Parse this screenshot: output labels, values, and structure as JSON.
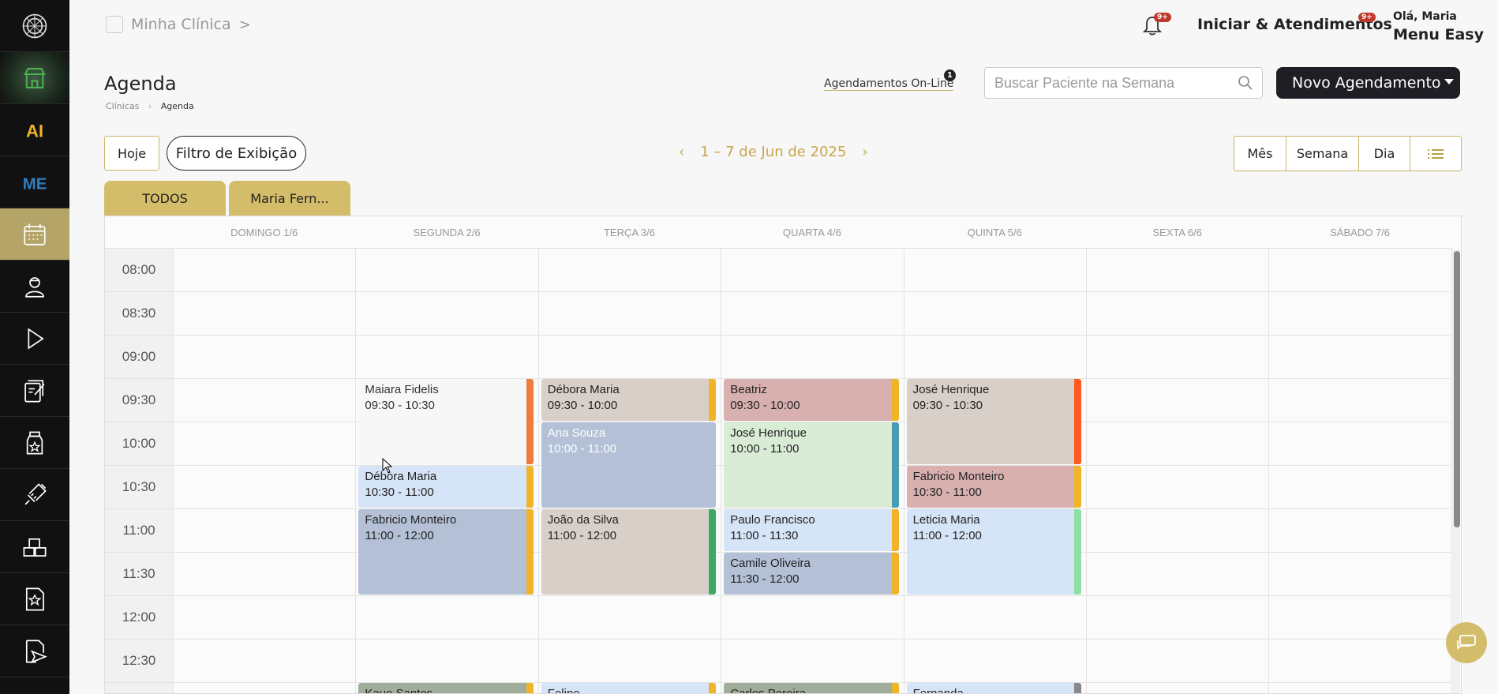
{
  "header": {
    "clinic_name": "Minha Clínica",
    "clinic_chevron": ">",
    "notif_badge": "9+",
    "iniciar_label": "Iniciar & Atendimentos",
    "iniciar_badge": "9+",
    "greeting": "Olá, Maria",
    "menu_label": "Menu Easy"
  },
  "page": {
    "title": "Agenda",
    "breadcrumb": [
      "Clínicas",
      "Agenda"
    ],
    "online_link": "Agendamentos On-Line",
    "online_badge": "1",
    "search_placeholder": "Buscar Paciente na Semana",
    "new_button": "Novo Agendamento"
  },
  "toolbar": {
    "today": "Hoje",
    "filter": "Filtro de Exibição",
    "date_range": "1 – 7 de Jun de 2025",
    "views": [
      "Mês",
      "Semana",
      "Dia"
    ]
  },
  "tabs": [
    "TODOS",
    "Maria Fern..."
  ],
  "days": [
    "DOMINGO 1/6",
    "SEGUNDA 2/6",
    "TERÇA 3/6",
    "QUARTA 4/6",
    "QUINTA 5/6",
    "SEXTA 6/6",
    "SÁBADO 7/6"
  ],
  "times": [
    "08:00",
    "08:30",
    "09:00",
    "09:30",
    "10:00",
    "10:30",
    "11:00",
    "11:30",
    "12:00",
    "12:30"
  ],
  "appointments": [
    {
      "name": "Maiara Fidelis",
      "time": "09:30 - 10:30",
      "day": 1,
      "start": 3,
      "slots": 2,
      "bg": "#f7f7f7",
      "bar": "#f07b3f",
      "text": "#333"
    },
    {
      "name": "Débora Maria",
      "time": "10:30 - 11:00",
      "day": 1,
      "start": 5,
      "slots": 1,
      "bg": "#d6e4f7",
      "bar": "#f0b429",
      "text": "#222"
    },
    {
      "name": "Fabricio Monteiro",
      "time": "11:00 - 12:00",
      "day": 1,
      "start": 6,
      "slots": 2,
      "bg": "#b3c0d6",
      "bar": "#f0b429",
      "text": "#222"
    },
    {
      "name": "Kaue Santos",
      "time": "",
      "day": 1,
      "start": 10,
      "slots": 1,
      "bg": "#9fad9a",
      "bar": "#f0b429",
      "text": "#222"
    },
    {
      "name": "Débora Maria",
      "time": "09:30 - 10:00",
      "day": 2,
      "start": 3,
      "slots": 1,
      "bg": "#d8cfc9",
      "bar": "#f0b429",
      "text": "#222"
    },
    {
      "name": "Ana Souza",
      "time": "10:00 - 11:00",
      "day": 2,
      "start": 4,
      "slots": 2,
      "bg": "#b3c0d6",
      "bar": "#b3c0d6",
      "text": "#ffffff"
    },
    {
      "name": "João da Silva",
      "time": "11:00 - 12:00",
      "day": 2,
      "start": 6,
      "slots": 2,
      "bg": "#d8cfc9",
      "bar": "#3fa862",
      "text": "#222"
    },
    {
      "name": "Felipe",
      "time": "",
      "day": 2,
      "start": 10,
      "slots": 1,
      "bg": "#d6e4f7",
      "bar": "#f0b429",
      "text": "#222"
    },
    {
      "name": "Beatriz",
      "time": "09:30 - 10:00",
      "day": 3,
      "start": 3,
      "slots": 1,
      "bg": "#d9b0b0",
      "bar": "#f0b429",
      "text": "#222"
    },
    {
      "name": "José Henrique",
      "time": "10:00 - 11:00",
      "day": 3,
      "start": 4,
      "slots": 2,
      "bg": "#d9ecd6",
      "bar": "#4a9db0",
      "text": "#222"
    },
    {
      "name": "Paulo Francisco",
      "time": "11:00 - 11:30",
      "day": 3,
      "start": 6,
      "slots": 1,
      "bg": "#d6e4f7",
      "bar": "#f0b429",
      "text": "#222"
    },
    {
      "name": "Camile Oliveira",
      "time": "11:30 - 12:00",
      "day": 3,
      "start": 7,
      "slots": 1,
      "bg": "#b3c0d6",
      "bar": "#f0b429",
      "text": "#222"
    },
    {
      "name": "Carlos Pereira",
      "time": "",
      "day": 3,
      "start": 10,
      "slots": 1,
      "bg": "#9fad9a",
      "bar": "#f0b429",
      "text": "#222"
    },
    {
      "name": "José Henrique",
      "time": "09:30 - 10:30",
      "day": 4,
      "start": 3,
      "slots": 2,
      "bg": "#d8cfc9",
      "bar": "#ff5a1f",
      "text": "#222"
    },
    {
      "name": "Fabricio Monteiro",
      "time": "10:30 - 11:00",
      "day": 4,
      "start": 5,
      "slots": 1,
      "bg": "#d9b0b0",
      "bar": "#f0b429",
      "text": "#222"
    },
    {
      "name": "Leticia Maria",
      "time": "11:00 - 12:00",
      "day": 4,
      "start": 6,
      "slots": 2,
      "bg": "#d6e4f7",
      "bar": "#8fe0a8",
      "text": "#222"
    },
    {
      "name": "Fernanda",
      "time": "",
      "day": 4,
      "start": 10,
      "slots": 1,
      "bg": "#d6e4f7",
      "bar": "#888888",
      "text": "#222"
    }
  ]
}
